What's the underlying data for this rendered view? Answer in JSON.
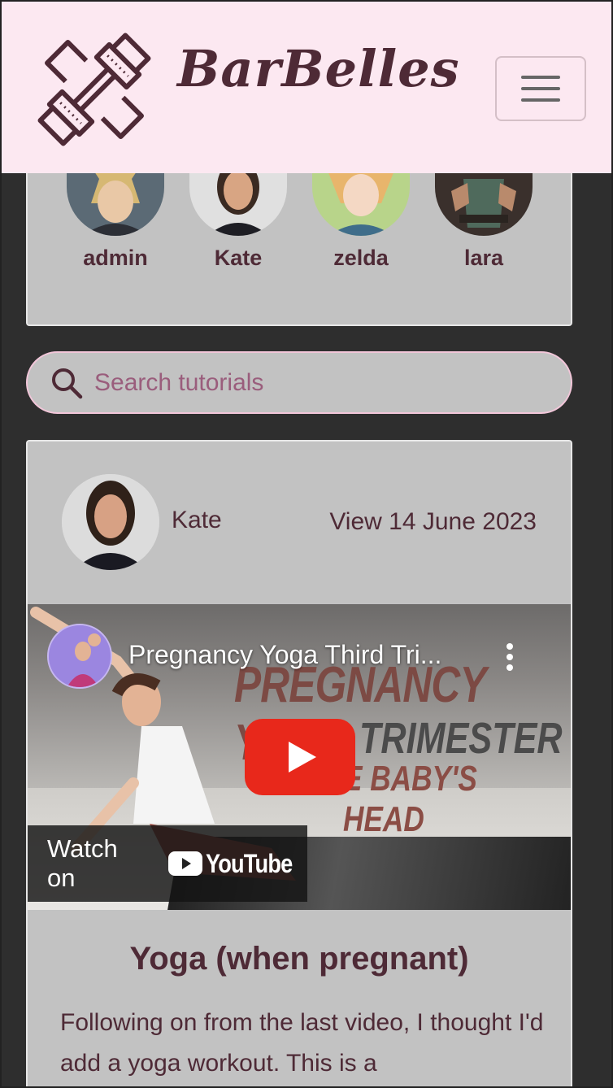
{
  "navbar": {
    "brand": "BarBelles",
    "logo_icon": "dumbbell-icon",
    "menu_icon": "hamburger-icon",
    "bg_color": "#fce8f1",
    "text_color": "#4e2a36"
  },
  "users": [
    {
      "name": "admin"
    },
    {
      "name": "Kate"
    },
    {
      "name": "zelda"
    },
    {
      "name": "lara"
    }
  ],
  "search": {
    "placeholder": "Search tutorials",
    "icon": "search-icon"
  },
  "post": {
    "author": "Kate",
    "view_label": "View 14 June 2023",
    "video": {
      "title": "Pregnancy Yoga Third Tri...",
      "overlay_line1": "PREGNANCY YOGA",
      "overlay_line2": "TRIMESTER",
      "overlay_line3": "E BABY'S HEAD",
      "watch_on": "Watch on",
      "youtube": "YouTube"
    },
    "title": "Yoga (when pregnant)",
    "body": "Following on from the last video, I thought I'd add a yoga workout. This is a"
  }
}
